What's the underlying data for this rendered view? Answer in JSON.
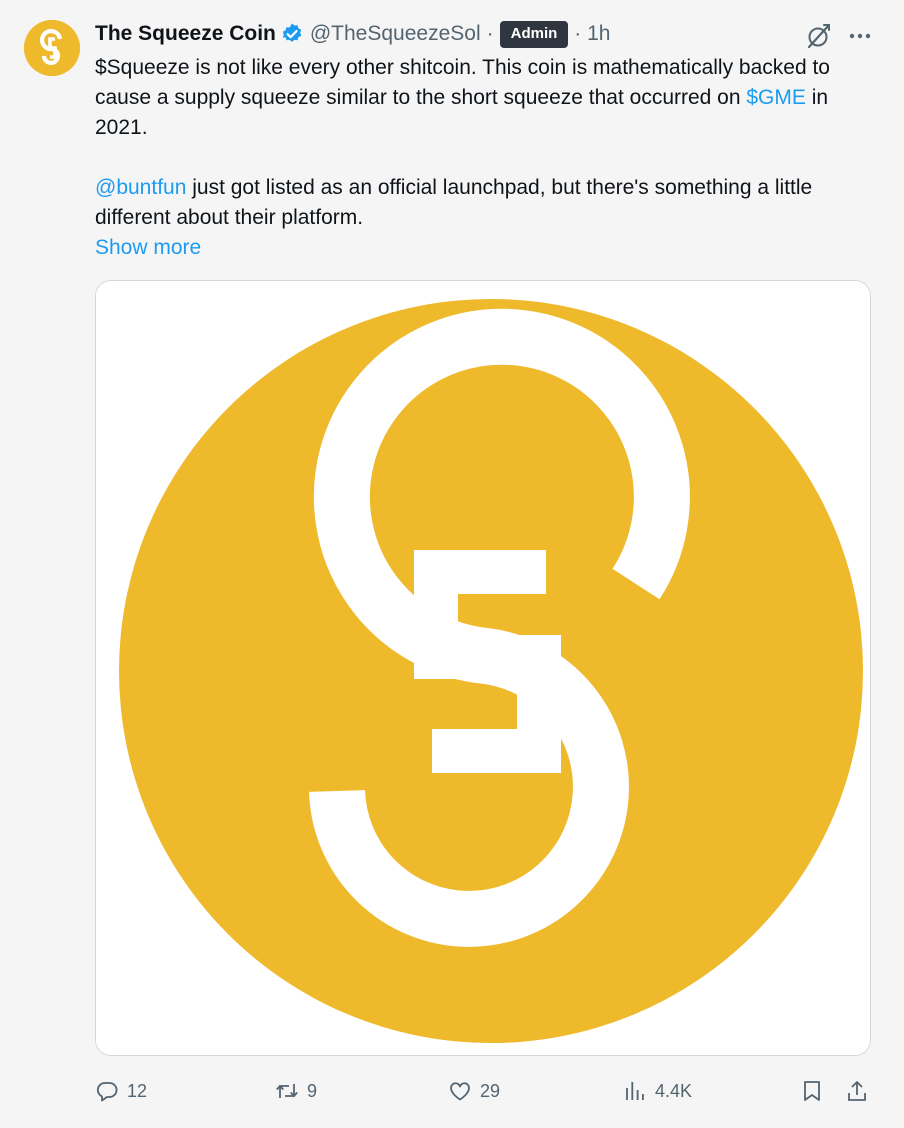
{
  "author": {
    "display_name": "The Squeeze Coin",
    "handle": "@TheSqueezeSol",
    "separator": "·",
    "badge": "Admin",
    "time_separator": "· 1h"
  },
  "tweet": {
    "para1_part1": "$Squeeze is not like every other shitcoin. This coin is mathematically backed to cause a supply squeeze similar to the short squeeze that occurred on ",
    "cashtag": "$GME",
    "para1_part2": " in 2021.",
    "mention": "@buntfun",
    "para2_rest": " just got listed as an official launchpad, but there's something a little different about their platform.",
    "show_more": "Show more"
  },
  "actions": {
    "replies": "12",
    "retweets": "9",
    "likes": "29",
    "views": "4.4K"
  },
  "colors": {
    "brand_yellow": "#efb92c",
    "link_blue": "#1d9bf0",
    "muted_gray": "#536471",
    "badge_bg": "#2f3640"
  },
  "icons": [
    "s-logo-avatar",
    "verified-badge-icon",
    "grok-icon",
    "more-icon",
    "reply-icon",
    "retweet-icon",
    "like-icon",
    "views-icon",
    "bookmark-icon",
    "share-icon"
  ]
}
